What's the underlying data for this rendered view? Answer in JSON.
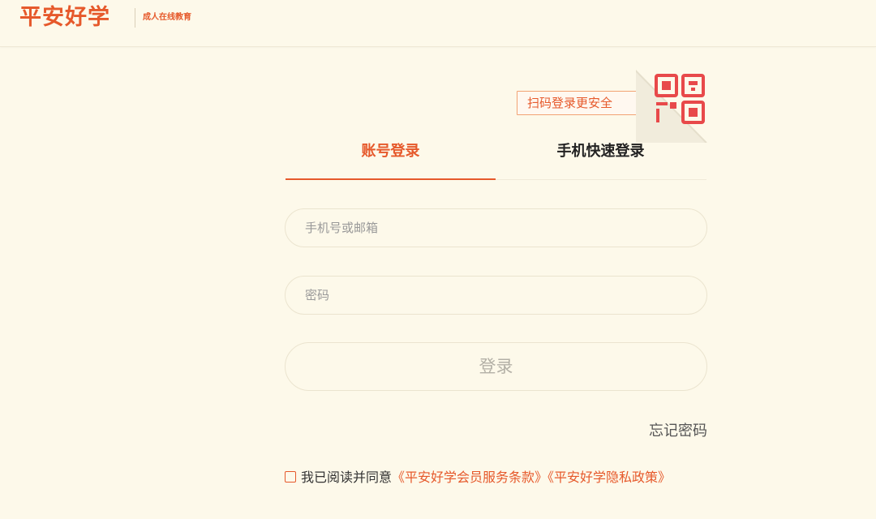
{
  "header": {
    "logo": "平安好学",
    "tagline": "成人在线教育"
  },
  "qr_login": {
    "tip": "扫码登录更安全",
    "icon": "qr-code-icon"
  },
  "tabs": [
    {
      "label": "账号登录",
      "active": true
    },
    {
      "label": "手机快速登录",
      "active": false
    }
  ],
  "form": {
    "account_placeholder": "手机号或邮箱",
    "password_placeholder": "密码",
    "login_label": "登录",
    "forgot_label": "忘记密码"
  },
  "agreement": {
    "prefix": "我已阅读并同意",
    "service_link": "《平安好学会员服务条款》",
    "privacy_link": "《平安好学隐私政策》"
  },
  "colors": {
    "accent": "#e6592b",
    "background": "#fdf9ea",
    "qr_red": "#e8494a"
  }
}
